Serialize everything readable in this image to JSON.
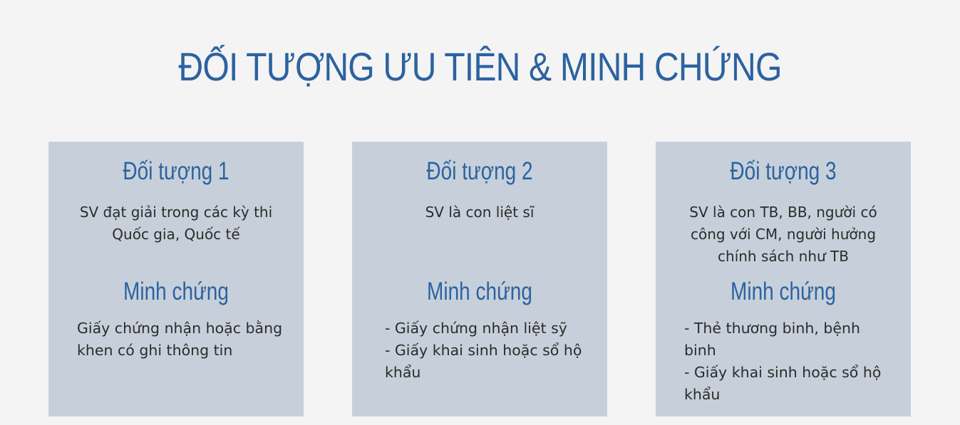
{
  "page": {
    "title": "ĐỐI TƯỢNG ƯU TIÊN & MINH CHỨNG"
  },
  "colors": {
    "background": "#f4f4f4",
    "card": "#c7d0da",
    "accent": "#2c62a0",
    "text": "#2b2b2b"
  },
  "cards": [
    {
      "heading": "Đối tượng 1",
      "description": "SV đạt giải trong các kỳ thi Quốc gia, Quốc tế",
      "evidence_heading": "Minh chứng",
      "evidence_items": [
        "Giấy chứng nhận hoặc bằng khen có ghi thông tin"
      ]
    },
    {
      "heading": "Đối tượng 2",
      "description": "SV là con liệt sĩ",
      "evidence_heading": "Minh chứng",
      "evidence_items": [
        "- Giấy chứng nhận liệt sỹ",
        "- Giấy khai sinh hoặc sổ hộ khẩu"
      ]
    },
    {
      "heading": "Đối tượng 3",
      "description": "SV là con TB, BB, người có công với CM, người hưởng chính sách như TB",
      "evidence_heading": "Minh chứng",
      "evidence_items": [
        "- Thẻ thương binh, bệnh binh",
        "- Giấy khai sinh hoặc sổ hộ khẩu"
      ]
    }
  ]
}
